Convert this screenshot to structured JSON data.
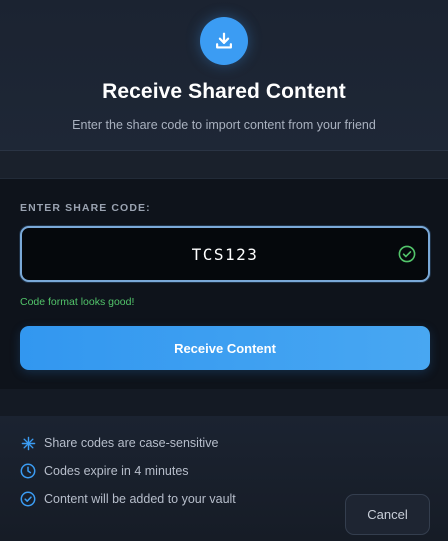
{
  "header": {
    "icon": "download-icon",
    "title": "Receive Shared Content",
    "subtitle": "Enter the share code to import content from your friend"
  },
  "form": {
    "label": "ENTER SHARE CODE:",
    "code_value": "TCS123",
    "validation_icon": "check-circle-icon",
    "hint": "Code format looks good!",
    "submit_label": "Receive Content"
  },
  "info": {
    "items": [
      {
        "icon": "asterisk-icon",
        "text": "Share codes are case-sensitive"
      },
      {
        "icon": "clock-icon",
        "text": "Codes expire in 4 minutes"
      },
      {
        "icon": "check-circle-icon",
        "text": "Content will be added to your vault"
      }
    ]
  },
  "footer": {
    "cancel_label": "Cancel"
  },
  "colors": {
    "accent": "#3b9cf3",
    "success": "#52c46a",
    "background": "#171d28",
    "panel": "#0e131b"
  }
}
